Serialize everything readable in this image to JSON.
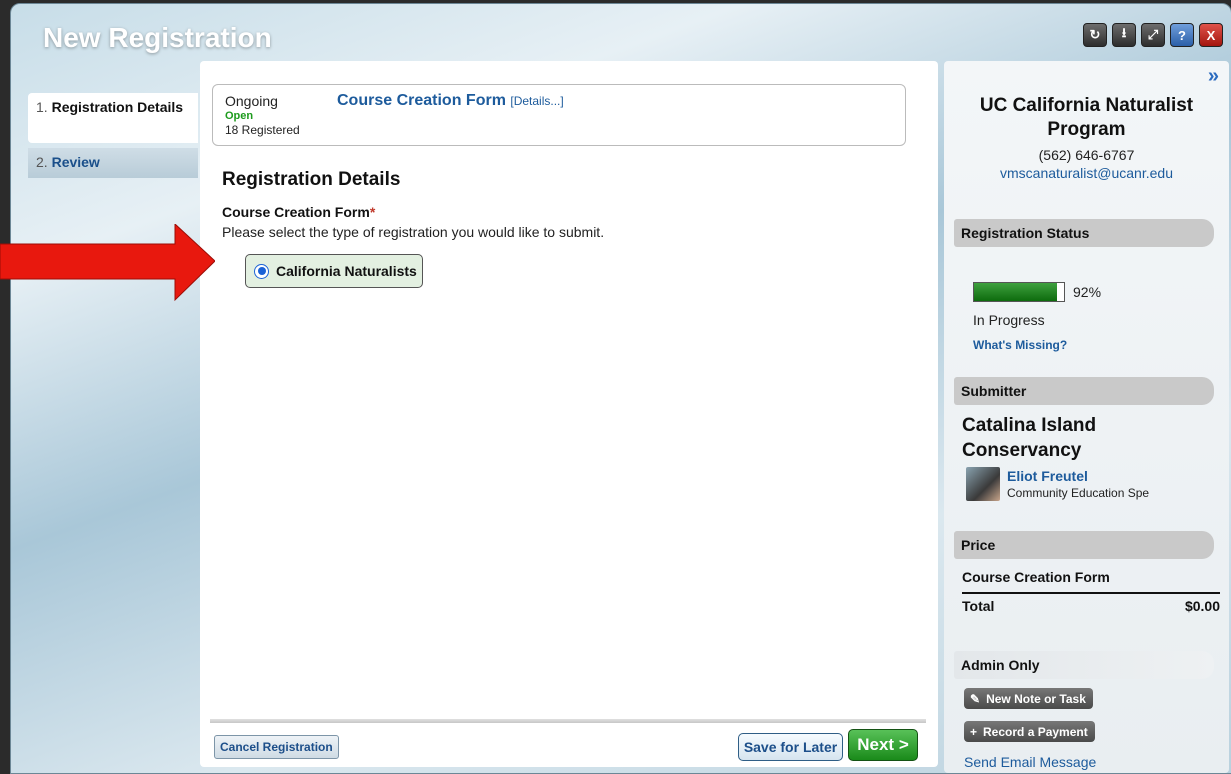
{
  "window": {
    "title": "New Registration",
    "buttons": [
      "refresh-icon",
      "download-icon",
      "expand-icon",
      "help-icon",
      "close-icon"
    ]
  },
  "steps": [
    {
      "num": "1.",
      "label": "Registration Details",
      "active": true
    },
    {
      "num": "2.",
      "label": "Review",
      "active": false
    }
  ],
  "main": {
    "info": {
      "status_line": "Ongoing",
      "open": "Open",
      "registered": "18 Registered",
      "course_title": "Course Creation Form",
      "details_link": "[Details...]"
    },
    "section_title": "Registration Details",
    "field_label": "Course Creation Form",
    "required_mark": "*",
    "field_desc": "Please select the type of registration you would like to submit.",
    "option_label": "California Naturalists",
    "option_selected": true
  },
  "footer": {
    "cancel": "Cancel Registration",
    "save": "Save for Later",
    "next": "Next >"
  },
  "sidebar": {
    "expand_icon": "»",
    "org_name": "UC California Naturalist Program",
    "phone": "(562) 646-6767",
    "email": "vmscanaturalist@ucanr.edu",
    "status_header": "Registration Status",
    "progress": 0.92,
    "progress_text": "92%",
    "status_text": "In Progress",
    "missing_link": "What's Missing?",
    "submitter_header": "Submitter",
    "submitter_org": "Catalina Island Conservancy",
    "person_name": "Eliot Freutel",
    "person_role": "Community Education Spe",
    "price_header": "Price",
    "price_item": "Course Creation Form",
    "total_label": "Total",
    "total_value": "$0.00",
    "admin_header": "Admin Only",
    "note_btn": "New Note or Task",
    "payment_btn": "Record a Payment",
    "send_email": "Send Email Message"
  },
  "colors": {
    "link": "#1d5b9c",
    "open_green": "#1d9b1d",
    "next_green": "#1a8a1a",
    "arrow_red": "#e8180e"
  }
}
